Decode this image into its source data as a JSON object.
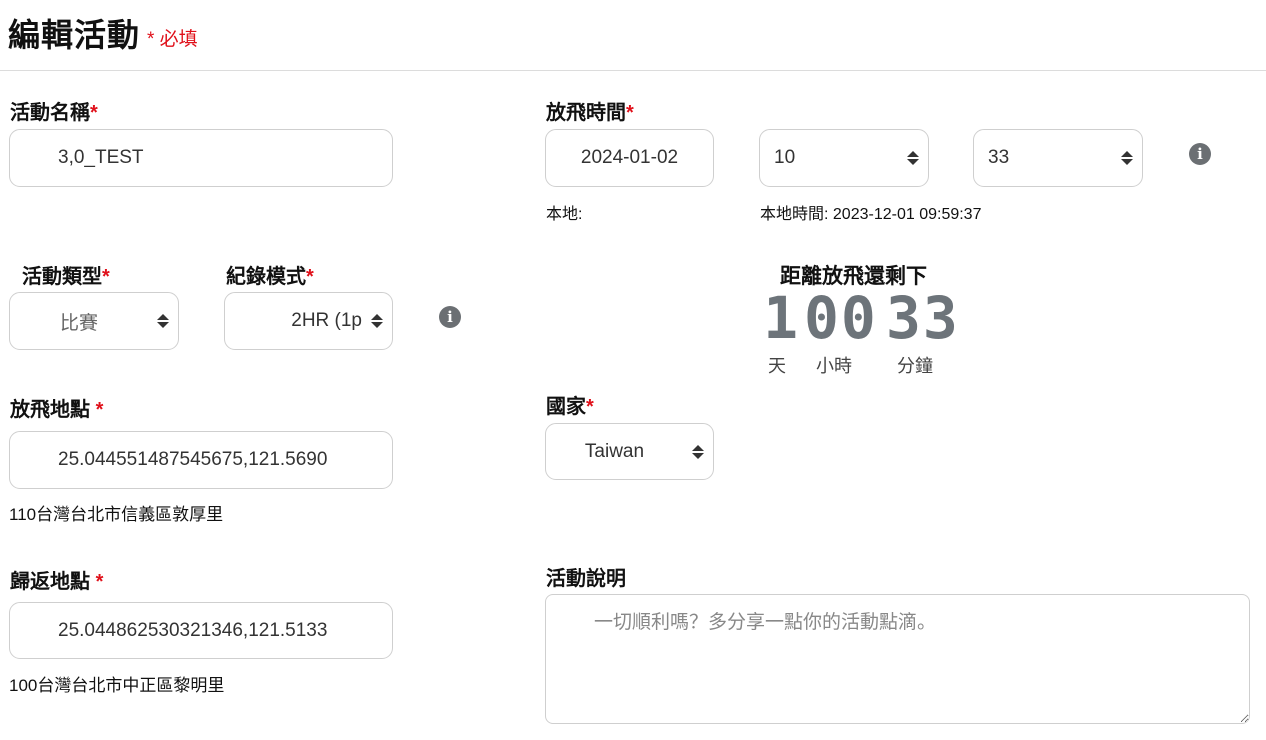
{
  "header": {
    "title": "編輯活動",
    "required_note": "* 必填"
  },
  "activity_name": {
    "label": "活動名稱",
    "value": "3,0_TEST"
  },
  "flight_time": {
    "label": "放飛時間",
    "date": "2024-01-02",
    "hour": "10",
    "minute": "33",
    "local_label": "本地:",
    "local_time_label": "本地時間:",
    "local_time_value": "2023-12-01 09:59:37"
  },
  "activity_type": {
    "label": "活動類型",
    "value": "比賽"
  },
  "record_mode": {
    "label": "紀錄模式",
    "value": "2HR (1p"
  },
  "countdown": {
    "title": "距離放飛還剩下",
    "days": "1",
    "hours": "00",
    "minutes": "33",
    "days_label": "天",
    "hours_label": "小時",
    "minutes_label": "分鐘"
  },
  "release_location": {
    "label": "放飛地點",
    "value": "25.044551487545675,121.5690",
    "address": "110台灣台北市信義區敦厚里"
  },
  "country": {
    "label": "國家",
    "value": "Taiwan"
  },
  "return_location": {
    "label": "歸返地點",
    "value": "25.044862530321346,121.5133",
    "address": "100台灣台北市中正區黎明里"
  },
  "description": {
    "label": "活動說明",
    "placeholder": "一切順利嗎？多分享一點你的活動點滴。"
  },
  "required_mark": "*",
  "icons": {
    "info": "info-icon",
    "select_arrows": "sort-arrows-icon"
  }
}
